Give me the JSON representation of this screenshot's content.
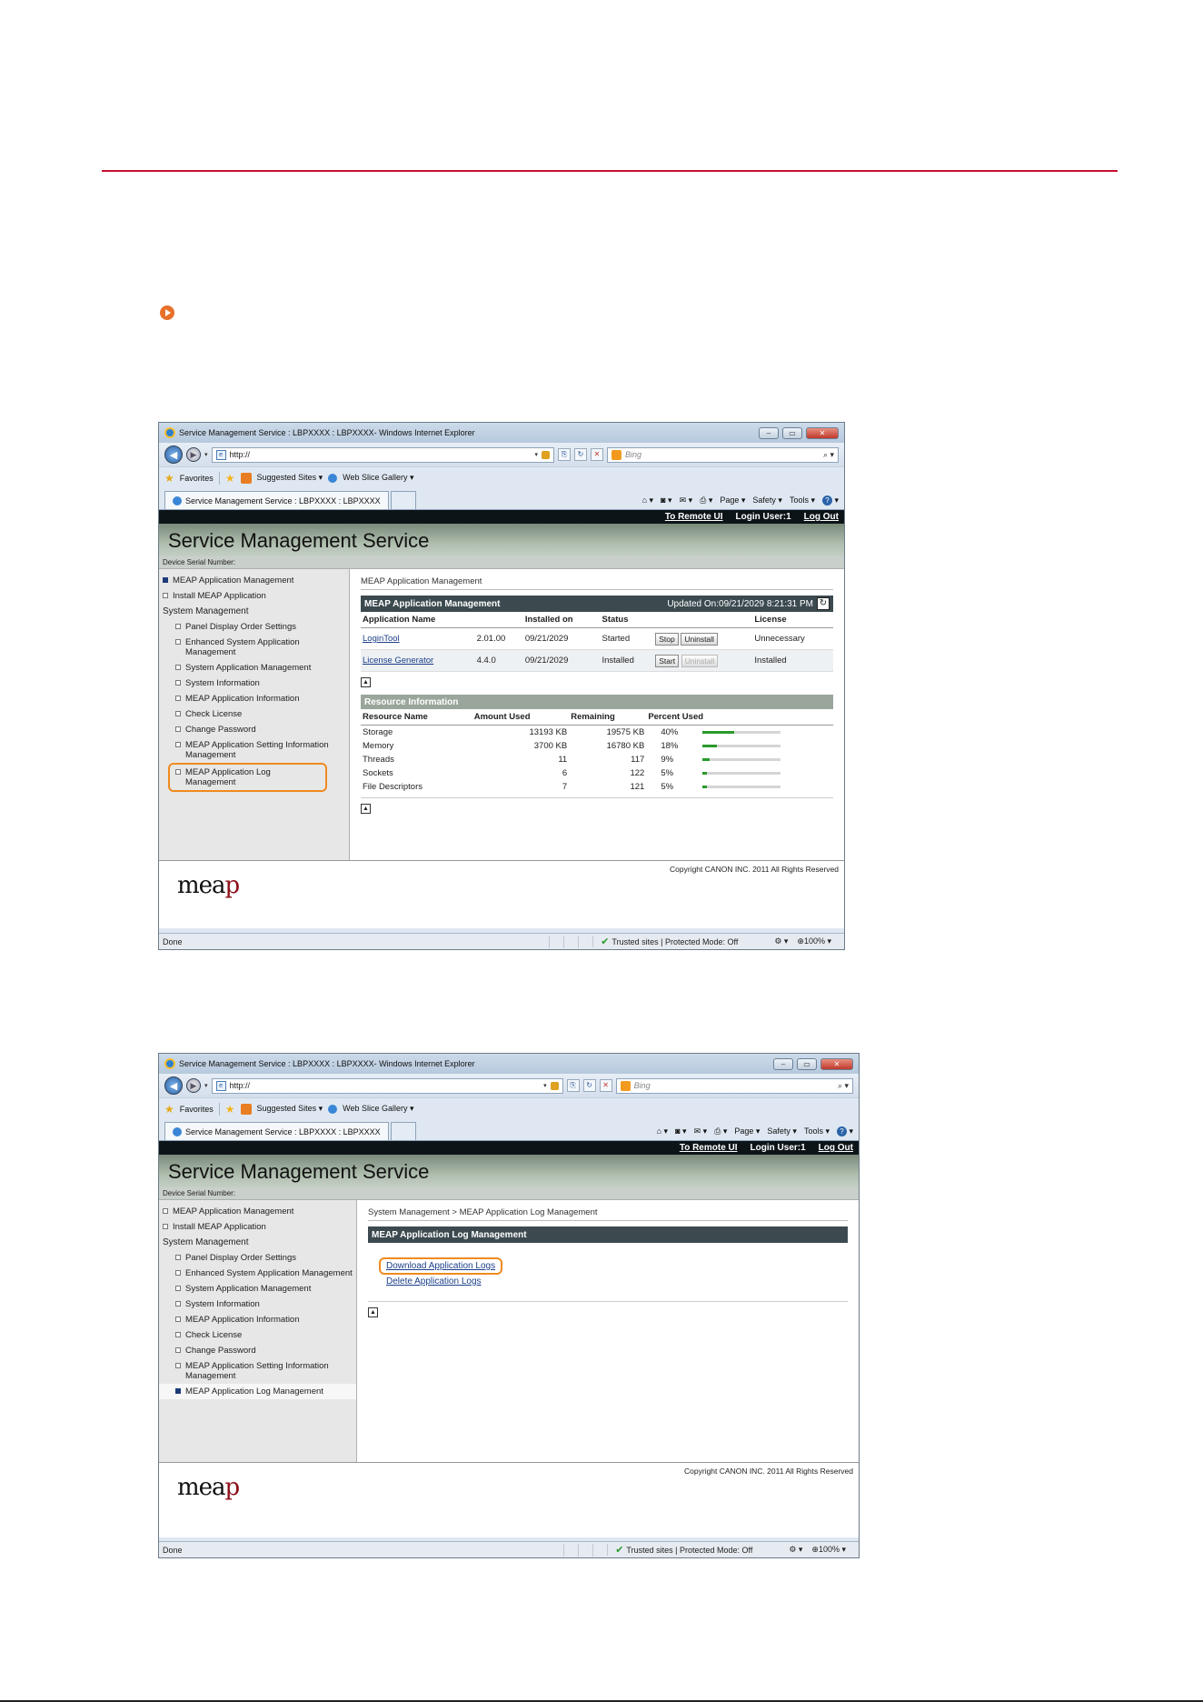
{
  "browser": {
    "window_title": "Service Management Service : LBPXXXX : LBPXXXX- Windows Internet Explorer",
    "address": "http://",
    "search_placeholder": "Bing",
    "favorites_label": "Favorites",
    "suggested_sites": "Suggested Sites ▾",
    "web_slice_gallery": "Web Slice Gallery ▾",
    "tab_label": "Service Management Service : LBPXXXX : LBPXXXX",
    "cmd_page": "Page ▾",
    "cmd_safety": "Safety ▾",
    "cmd_tools": "Tools ▾",
    "status_done": "Done",
    "status_trusted": "Trusted sites | Protected Mode: Off",
    "status_zoom": "⊕100%  ▾"
  },
  "site": {
    "to_remote_ui": "To Remote UI",
    "login_user": "Login User:1",
    "log_out": "Log Out",
    "banner_title": "Service Management Service",
    "device_serial": "Device Serial Number:",
    "copyright": "Copyright CANON INC. 2011 All Rights Reserved",
    "logo_pre": "mea",
    "logo_p": "p"
  },
  "sidebar": {
    "top_items": [
      "MEAP Application Management",
      "Install MEAP Application"
    ],
    "system_management": "System Management",
    "sub_items": [
      "Panel Display Order Settings",
      "Enhanced System Application Management",
      "System Application Management",
      "System Information",
      "MEAP Application Information",
      "Check License",
      "Change Password",
      "MEAP Application Setting Information Management",
      "MEAP Application Log Management"
    ]
  },
  "screen1": {
    "breadcrumb": "MEAP Application Management",
    "header": "MEAP Application Management",
    "updated": "Updated On:09/21/2029 8:21:31 PM",
    "columns": [
      "Application Name",
      "Installed on",
      "Status",
      "License"
    ],
    "apps": [
      {
        "name": "LoginTool",
        "version": "2.01.00",
        "installed": "09/21/2029",
        "status": "Started",
        "btn1": "Stop",
        "btn2": "Uninstall",
        "license": "Unnecessary"
      },
      {
        "name": "License Generator",
        "version": "4.4.0",
        "installed": "09/21/2029",
        "status": "Installed",
        "btn1": "Start",
        "btn2": "Uninstall",
        "license": "Installed"
      }
    ],
    "resource_header": "Resource Information",
    "resource_columns": [
      "Resource Name",
      "Amount Used",
      "Remaining",
      "Percent Used"
    ],
    "resources": [
      {
        "name": "Storage",
        "used": "13193 KB",
        "remaining": "19575 KB",
        "percent": "40%",
        "fraction": 0.4
      },
      {
        "name": "Memory",
        "used": "3700 KB",
        "remaining": "16780 KB",
        "percent": "18%",
        "fraction": 0.18
      },
      {
        "name": "Threads",
        "used": "11",
        "remaining": "117",
        "percent": "9%",
        "fraction": 0.09
      },
      {
        "name": "Sockets",
        "used": "6",
        "remaining": "122",
        "percent": "5%",
        "fraction": 0.05
      },
      {
        "name": "File Descriptors",
        "used": "7",
        "remaining": "121",
        "percent": "5%",
        "fraction": 0.05
      }
    ]
  },
  "screen2": {
    "breadcrumb": "System Management > MEAP Application Log Management",
    "header": "MEAP Application Log Management",
    "download_link": "Download Application Logs",
    "delete_link": "Delete Application Logs"
  }
}
